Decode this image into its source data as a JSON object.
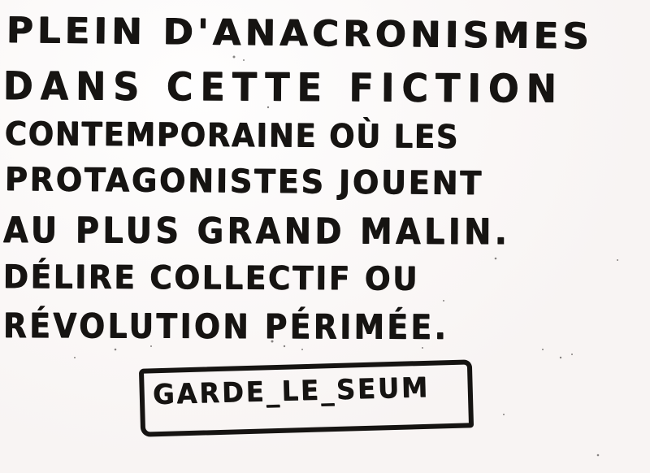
{
  "note": {
    "lines": [
      "PLEIN D'ANACRONISMES",
      "DANS CETTE FICTION",
      "CONTEMPORAINE OÙ LES",
      "PROTAGONISTES JOUENT",
      "AU PLUS GRAND MALIN.",
      "DÉLIRE COLLECTIF OU",
      "RÉVOLUTION PÉRIMÉE."
    ],
    "signature": "GARDE_LE_SEUM"
  },
  "colors": {
    "ink": "#161412",
    "paper": "#f7f3f2"
  }
}
